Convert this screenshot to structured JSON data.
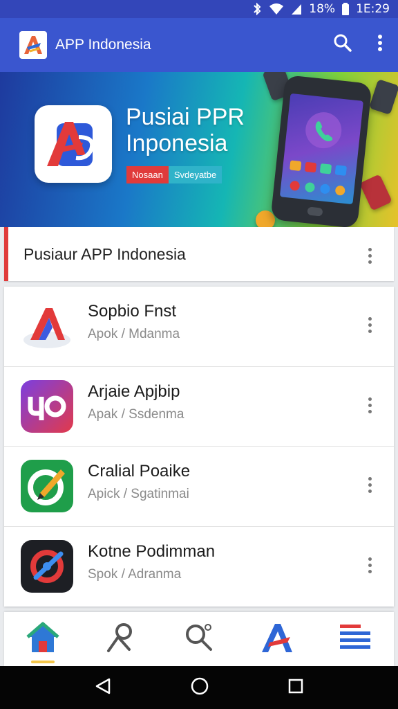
{
  "status_bar": {
    "battery": "18%",
    "time": "1E:29"
  },
  "app_bar": {
    "title": "APP Indonesia",
    "background_color": "#3a56cf"
  },
  "banner": {
    "title_line1": "Pusiai PPR",
    "title_line2": "Inponesia",
    "chip_left": "Nosaan",
    "chip_right": "Svdeyatbe"
  },
  "section": {
    "title": "Pusiaur APP Indonesia"
  },
  "apps": [
    {
      "name": "Sopbio Fnst",
      "subtitle": "Apok / Mdanma",
      "icon": "arrow-logo-icon"
    },
    {
      "name": "Arjaie Apjbip",
      "subtitle": "Apak / Ssdenma",
      "icon": "yo-logo-icon"
    },
    {
      "name": "Cralial Poaike",
      "subtitle": "Apick / Sgatinmai",
      "icon": "pen-circle-icon"
    },
    {
      "name": "Kotne Podimman",
      "subtitle": "Spok / Adranma",
      "icon": "ring-logo-icon"
    }
  ],
  "bottom_nav": [
    {
      "icon": "home-icon"
    },
    {
      "icon": "person-search-icon"
    },
    {
      "icon": "search-icon"
    },
    {
      "icon": "app-logo-icon"
    },
    {
      "icon": "menu-icon"
    }
  ],
  "colors": {
    "accent_red": "#e03b3b",
    "primary_blue": "#3a56cf"
  }
}
